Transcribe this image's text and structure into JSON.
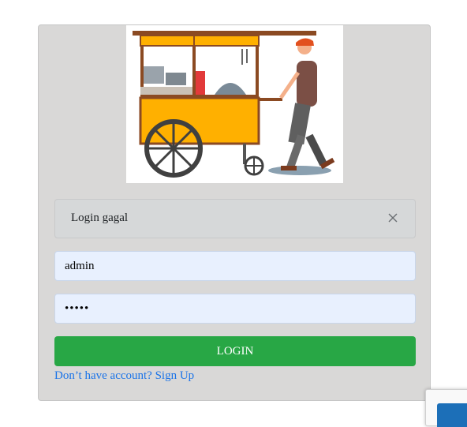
{
  "alert": {
    "message": "Login gagal"
  },
  "form": {
    "username_value": "admin",
    "password_value": "admin",
    "login_label": "LOGIN",
    "signup_prompt": "Don’t have account?",
    "signup_link": "Sign Up"
  },
  "colors": {
    "card_bg": "#d9d8d7",
    "alert_bg": "#d6d8d9",
    "input_bg": "#e8f0fe",
    "button_bg": "#28a745",
    "link": "#1a73e8"
  },
  "icons": {
    "alert_close": "close-icon",
    "illustration": "food-cart-vendor-illustration",
    "corner_widget": "recaptcha-icon"
  }
}
